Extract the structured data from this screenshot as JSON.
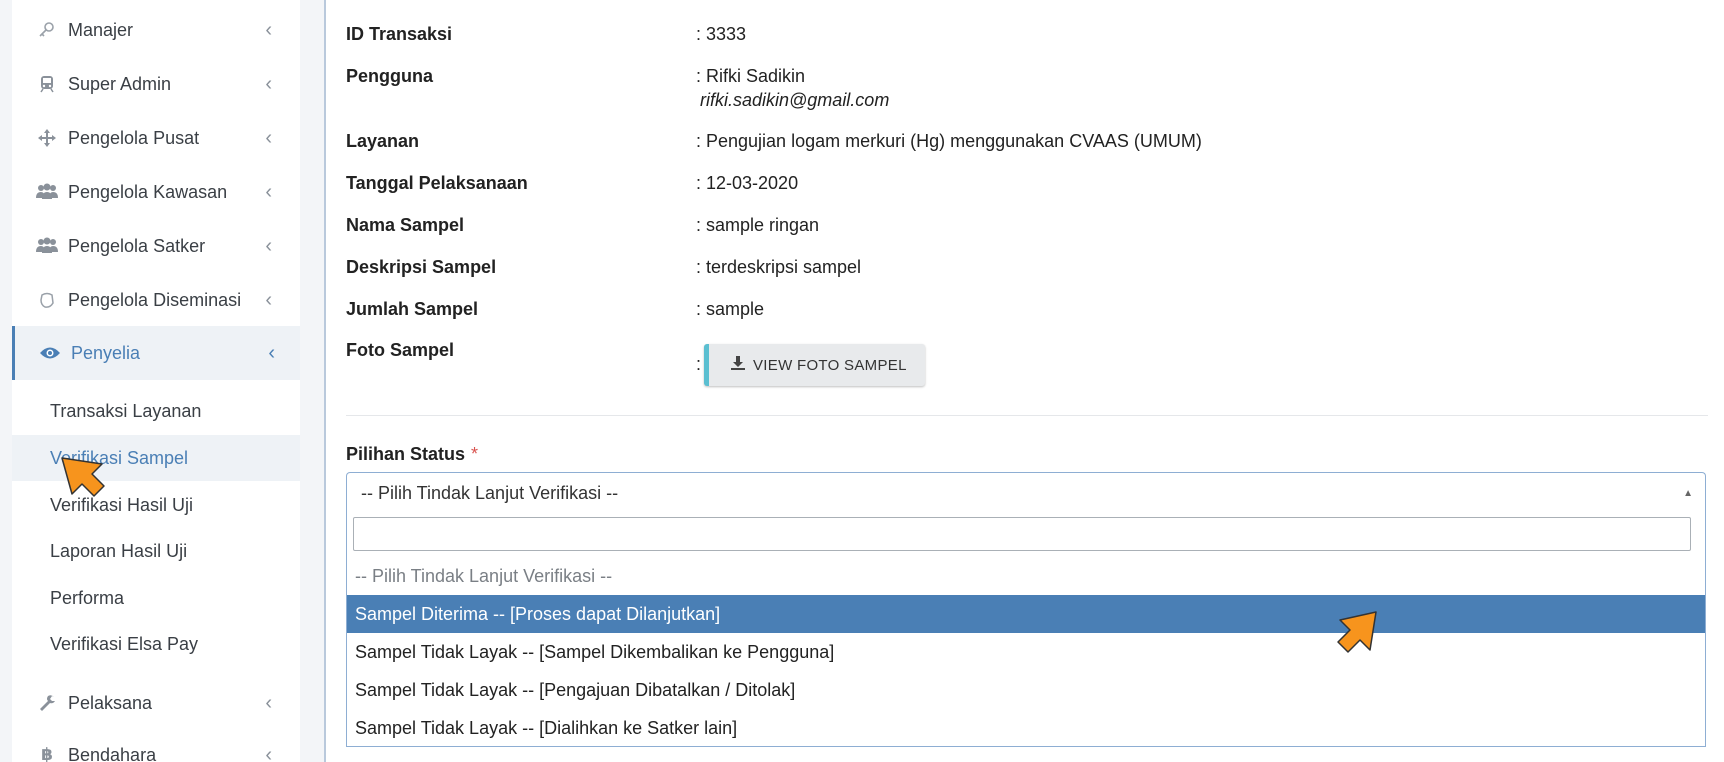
{
  "sidebar": {
    "items": [
      {
        "label": "Manajer",
        "icon": "key-icon"
      },
      {
        "label": "Super Admin",
        "icon": "train-icon"
      },
      {
        "label": "Pengelola Pusat",
        "icon": "move-arrows-icon"
      },
      {
        "label": "Pengelola Kawasan",
        "icon": "users-icon"
      },
      {
        "label": "Pengelola Satker",
        "icon": "users-icon"
      },
      {
        "label": "Pengelola Diseminasi",
        "icon": "hand-icon"
      },
      {
        "label": "Penyelia",
        "icon": "eye-icon"
      }
    ],
    "sub_items": [
      "Transaksi Layanan",
      "Verifikasi Sampel",
      "Verifikasi Hasil Uji",
      "Laporan Hasil Uji",
      "Performa",
      "Verifikasi Elsa Pay"
    ],
    "bottom_items": [
      {
        "label": "Pelaksana",
        "icon": "wrench-icon"
      },
      {
        "label": "Bendahara",
        "icon": "bitcoin-icon"
      }
    ]
  },
  "detail": {
    "rows": [
      {
        "key": "ID Transaksi",
        "value": ": 3333"
      },
      {
        "key": "Pengguna",
        "value": ": Rifki Sadikin",
        "value2": "rifki.sadikin@gmail.com"
      },
      {
        "key": "Layanan",
        "value": ": Pengujian logam merkuri (Hg) menggunakan CVAAS (UMUM)"
      },
      {
        "key": "Tanggal Pelaksanaan",
        "value": ": 12-03-2020"
      },
      {
        "key": "Nama Sampel",
        "value": ": sample ringan"
      },
      {
        "key": "Deskripsi Sampel",
        "value": ": terdeskripsi sampel"
      },
      {
        "key": "Jumlah Sampel",
        "value": ": sample"
      },
      {
        "key": "Foto Sampel",
        "value": ":"
      }
    ],
    "view_foto_label": "VIEW FOTO SAMPEL"
  },
  "status": {
    "label": "Pilihan Status",
    "required_mark": "*",
    "selected": "-- Pilih Tindak Lanjut Verifikasi --",
    "search_value": "",
    "options": [
      "-- Pilih Tindak Lanjut Verifikasi --",
      "Sampel Diterima -- [Proses dapat Dilanjutkan]",
      "Sampel Tidak Layak -- [Sampel Dikembalikan ke Pengguna]",
      "Sampel Tidak Layak -- [Pengajuan Dibatalkan / Ditolak]",
      "Sampel Tidak Layak -- [Dialihkan ke Satker lain]"
    ]
  },
  "colors": {
    "accent": "#4a7fb5",
    "highlight": "#4a7fb5",
    "cursor": "#f7941d",
    "button_accent": "#5bbfd1"
  }
}
